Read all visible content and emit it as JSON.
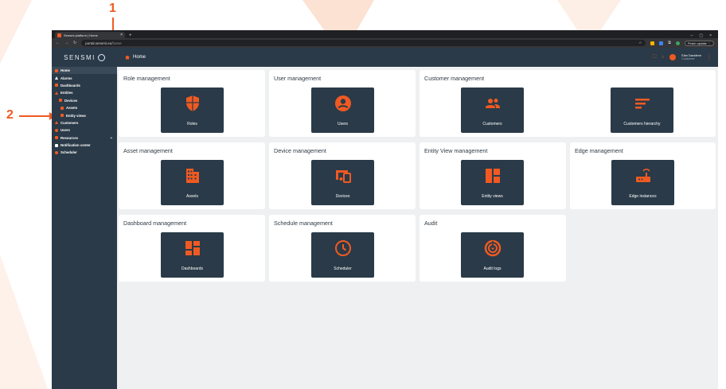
{
  "annotations": {
    "marker1": "1",
    "marker2": "2"
  },
  "browser": {
    "tab_title": "Sensmi platform | Home",
    "tab_close": "×",
    "new_tab": "+",
    "window_controls": [
      "–",
      "▢",
      "×"
    ],
    "url_host": "portal.sensmi.eu",
    "url_path": "/home",
    "finish_update_label": "Finish update",
    "finish_update_menu": "⋮"
  },
  "app": {
    "logo_text": "SENSMI",
    "breadcrumb": "Home",
    "user": {
      "name": "Elan Davidenn",
      "role": "Customer"
    },
    "accent_color": "#f05a22",
    "sidebar_color": "#2a3a48"
  },
  "sidebar": {
    "items": [
      {
        "label": "Home",
        "icon": "home-icon"
      },
      {
        "label": "Alarms",
        "icon": "alarm-icon"
      },
      {
        "label": "Dashboards",
        "icon": "dashboard-icon"
      },
      {
        "label": "Entities",
        "icon": "entities-icon"
      },
      {
        "label": "Devices",
        "icon": "device-icon"
      },
      {
        "label": "Assets",
        "icon": "asset-icon"
      },
      {
        "label": "Entity views",
        "icon": "entity-view-icon"
      },
      {
        "label": "Customers",
        "icon": "customers-icon"
      },
      {
        "label": "Users",
        "icon": "user-icon"
      },
      {
        "label": "Resources",
        "icon": "resources-icon"
      },
      {
        "label": "Notification center",
        "icon": "notification-icon"
      },
      {
        "label": "Scheduler",
        "icon": "scheduler-icon"
      }
    ],
    "resources_chevron": "⌄"
  },
  "cards": [
    {
      "title": "Role management",
      "tiles": [
        "Roles"
      ]
    },
    {
      "title": "User management",
      "tiles": [
        "Users"
      ]
    },
    {
      "title": "Customer management",
      "tiles": [
        "Customers",
        "Customers hierarchy"
      ]
    },
    {
      "title": "Asset management",
      "tiles": [
        "Assets"
      ]
    },
    {
      "title": "Device management",
      "tiles": [
        "Devices"
      ]
    },
    {
      "title": "Entity View management",
      "tiles": [
        "Entity views"
      ]
    },
    {
      "title": "Edge management",
      "tiles": [
        "Edge instances"
      ]
    },
    {
      "title": "Dashboard management",
      "tiles": [
        "Dashboards"
      ]
    },
    {
      "title": "Schedule management",
      "tiles": [
        "Scheduler"
      ]
    },
    {
      "title": "Audit",
      "tiles": [
        "Audit logs"
      ]
    }
  ]
}
